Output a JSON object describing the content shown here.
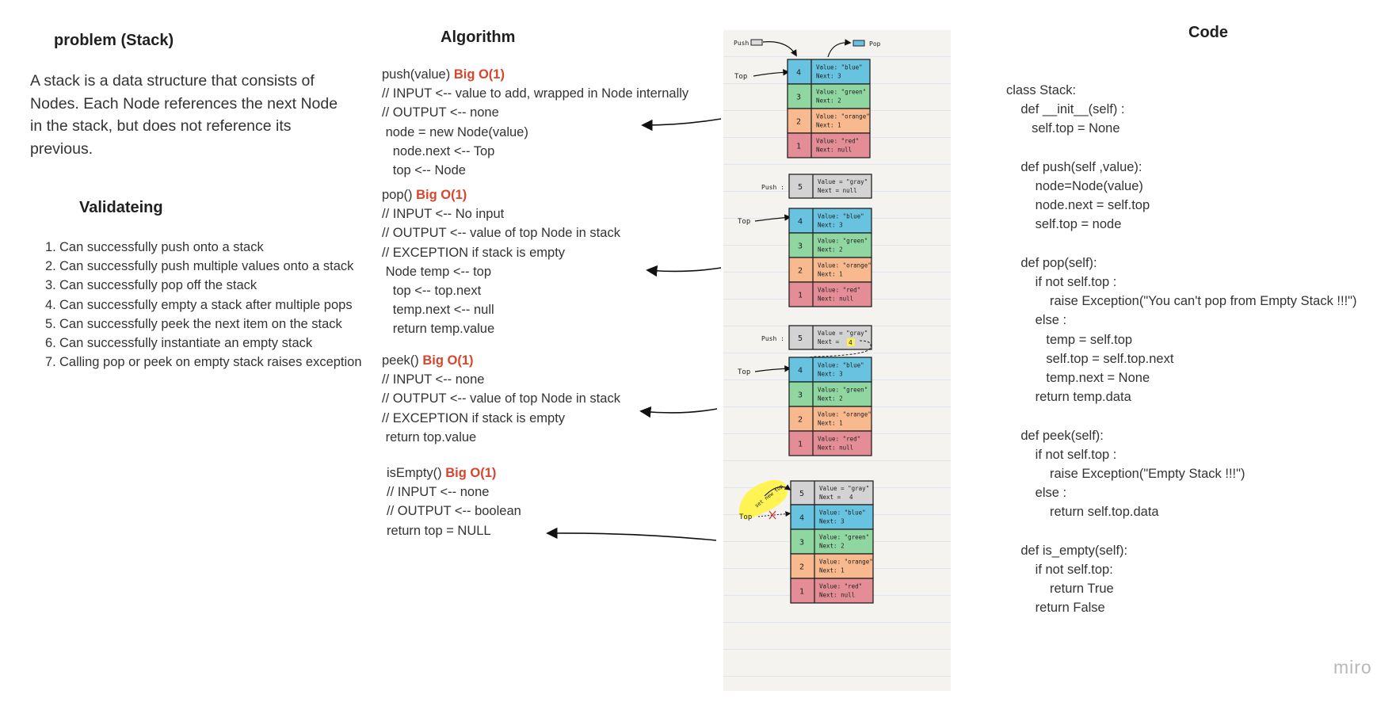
{
  "problem": {
    "title": "problem (Stack)",
    "description": "A stack is a data structure that consists of Nodes. Each Node references the next Node in the stack, but does not reference its previous."
  },
  "validating": {
    "title": "Validateing",
    "items": [
      "Can successfully push onto a stack",
      "Can successfully push multiple values onto a stack",
      "Can successfully pop off the stack",
      "Can successfully empty a stack after multiple pops",
      "Can successfully peek the next item on the stack",
      "Can successfully instantiate an empty stack",
      "Calling pop or peek on empty stack raises exception"
    ]
  },
  "algorithm": {
    "title": "Algorithm",
    "big_o": "Big O(1)",
    "push": {
      "signature": "push(value)",
      "lines": [
        "// INPUT <-- value to add, wrapped in Node internally",
        "// OUTPUT <-- none",
        " node = new Node(value)",
        "   node.next <-- Top",
        "   top <-- Node"
      ]
    },
    "pop": {
      "signature": "pop()",
      "lines": [
        "// INPUT <-- No input",
        "// OUTPUT <-- value of top Node in stack",
        "// EXCEPTION if stack is empty",
        " Node temp <-- top",
        "   top <-- top.next",
        "   temp.next <-- null",
        "   return temp.value"
      ]
    },
    "peek": {
      "signature": "peek()",
      "lines": [
        "// INPUT <-- none",
        "// OUTPUT <-- value of top Node in stack",
        "// EXCEPTION if stack is empty",
        " return top.value"
      ]
    },
    "is_empty": {
      "signature": "isEmpty()",
      "lines": [
        "// INPUT <-- none",
        "// OUTPUT <-- boolean",
        "return top = NULL"
      ]
    }
  },
  "code": {
    "title": "Code",
    "lines": [
      "class Stack:",
      "    def __init__(self) :",
      "       self.top = None",
      "",
      "    def push(self ,value):",
      "        node=Node(value)",
      "        node.next = self.top",
      "        self.top = node",
      "",
      "    def pop(self):",
      "        if not self.top :",
      "            raise Exception(\"You can't pop from Empty Stack !!!\")",
      "        else :",
      "           temp = self.top",
      "           self.top = self.top.next",
      "           temp.next = None",
      "        return temp.data",
      "",
      "    def peek(self):",
      "        if not self.top :",
      "            raise Exception(\"Empty Stack !!!\")",
      "        else :",
      "            return self.top.data",
      "",
      "    def is_empty(self):",
      "        if not self.top:",
      "            return True",
      "        return False"
    ]
  },
  "diagram": {
    "labels": {
      "push": "Push",
      "pop": "Pop",
      "top": "Top",
      "push_colon": "Push :",
      "new_top": "set new top"
    },
    "colors": {
      "blue": "#67c3e0",
      "green": "#90d6a1",
      "orange": "#f7b98d",
      "red": "#e48d97",
      "gray": "#d3d3d3",
      "highlight": "#fff34a"
    },
    "nodes": [
      {
        "num": "4",
        "value": "Value: \"blue\"",
        "next": "Next: 3",
        "color": "blue"
      },
      {
        "num": "3",
        "value": "Value: \"green\"",
        "next": "Next: 2",
        "color": "green"
      },
      {
        "num": "2",
        "value": "Value: \"orange\"",
        "next": "Next: 1",
        "color": "orange"
      },
      {
        "num": "1",
        "value": "Value: \"red\"",
        "next": "Next: null",
        "color": "red"
      }
    ],
    "new_node": {
      "num": "5",
      "value": "Value = \"gray\"",
      "next_null": "Next = null",
      "next_label": "Next =",
      "next_ref": "4",
      "color": "gray"
    }
  },
  "watermark": "miro"
}
